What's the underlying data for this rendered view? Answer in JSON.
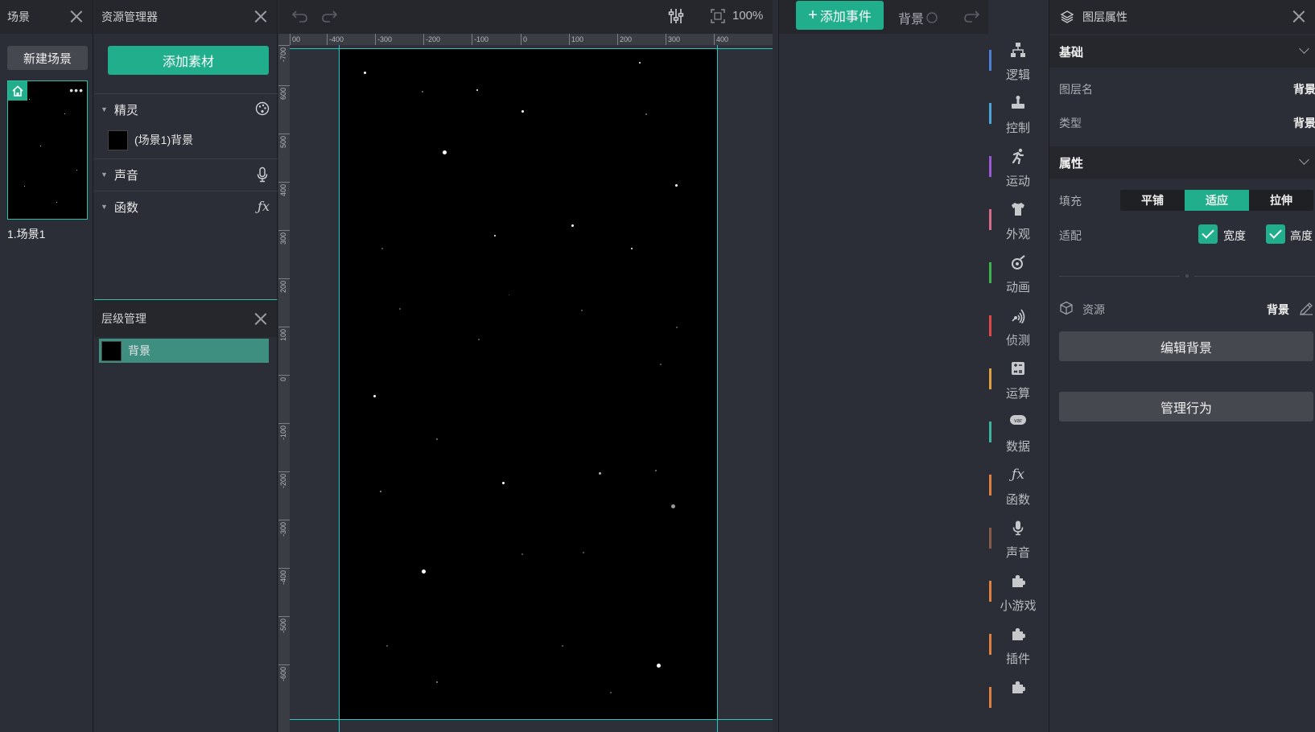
{
  "scene_panel": {
    "title": "场景",
    "new_scene": "新建场景",
    "scene_name": "1.场景1"
  },
  "asset_panel": {
    "title": "资源管理器",
    "add_asset": "添加素材",
    "sections": {
      "sprite": "精灵",
      "sprite_item": "(场景1)背景",
      "sound": "声音",
      "function": "函数"
    }
  },
  "layer_panel": {
    "title": "层级管理",
    "items": [
      {
        "label": "背景"
      }
    ]
  },
  "editor": {
    "zoom": "100%",
    "ruler_top": [
      "00",
      "-400",
      "-300",
      "-200",
      "-100",
      "0",
      "100",
      "200",
      "300",
      "400"
    ],
    "ruler_left": [
      "-700",
      "600",
      "500",
      "400",
      "300",
      "200",
      "100",
      "0",
      "-100",
      "-200",
      "-300",
      "-400",
      "-500",
      "-600"
    ]
  },
  "event_area": {
    "add_event": "添加事件",
    "current_object": "背景"
  },
  "categories": [
    {
      "label": "逻辑",
      "icon": "logic-icon",
      "color": "#4b7fd6"
    },
    {
      "label": "控制",
      "icon": "control-icon",
      "color": "#4aa3d9"
    },
    {
      "label": "运动",
      "icon": "motion-icon",
      "color": "#9b59d6"
    },
    {
      "label": "外观",
      "icon": "appearance-icon",
      "color": "#d66b8a"
    },
    {
      "label": "动画",
      "icon": "animation-icon",
      "color": "#3cb44b"
    },
    {
      "label": "侦测",
      "icon": "sensing-icon",
      "color": "#e04848"
    },
    {
      "label": "运算",
      "icon": "operator-icon",
      "color": "#e0a040"
    },
    {
      "label": "数据",
      "icon": "data-icon",
      "color": "#3cb4a0"
    },
    {
      "label": "函数",
      "icon": "function-icon",
      "color": "#e08040"
    },
    {
      "label": "声音",
      "icon": "sound-icon",
      "color": "#8a5a4a"
    },
    {
      "label": "小游戏",
      "icon": "minigame-icon",
      "color": "#e08040"
    },
    {
      "label": "插件",
      "icon": "plugin-icon",
      "color": "#e08040"
    },
    {
      "label": "",
      "icon": "extension-icon",
      "color": "#e08040"
    }
  ],
  "props": {
    "title": "图层属性",
    "basic": "基础",
    "layer_name_label": "图层名",
    "layer_name_value": "背景",
    "type_label": "类型",
    "type_value": "背景",
    "attributes": "属性",
    "fill_label": "填充",
    "fill_options": [
      "平铺",
      "适应",
      "拉伸"
    ],
    "fill_selected": "适应",
    "fit_label": "适配",
    "fit_width": "宽度",
    "fit_height": "高度",
    "resource_label": "资源",
    "resource_value": "背景",
    "edit_bg": "编辑背景",
    "manage_behavior": "管理行为"
  }
}
